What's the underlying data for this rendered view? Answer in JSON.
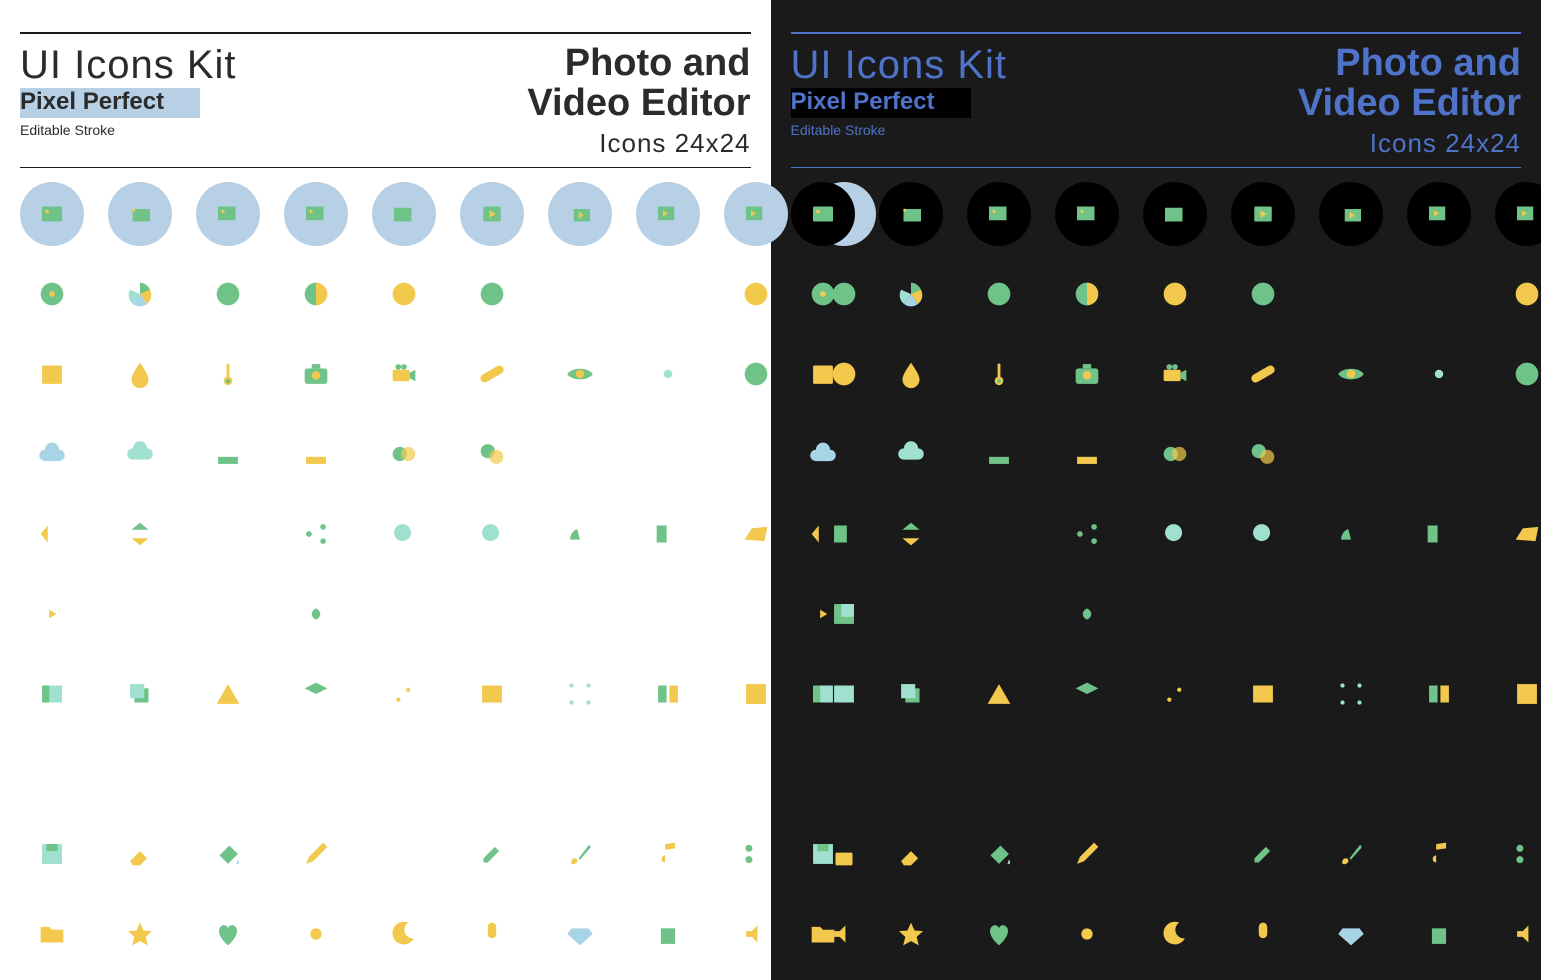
{
  "header": {
    "kit_title": "UI Icons Kit",
    "subtitle1": "Pixel Perfect",
    "subtitle2": "Editable Stroke",
    "right_line1": "Photo and",
    "right_line2": "Video Editor",
    "right_line3": "Icons 24x24"
  },
  "colors": {
    "light_bg": "#ffffff",
    "dark_bg": "#1a1a1a",
    "accent_light": "#b8d0e6",
    "accent_dark": "#4e73c8",
    "green": "#6fc388",
    "yellow": "#f2c94c",
    "blue": "#a8d5e6",
    "mint": "#9fe0d0"
  },
  "icons": [
    [
      {
        "n": "image",
        "c": true
      },
      {
        "n": "images",
        "c": true
      },
      {
        "n": "image-add",
        "c": true
      },
      {
        "n": "image-remove",
        "c": true
      },
      {
        "n": "image-sparkle",
        "c": true
      },
      {
        "n": "video",
        "c": true
      },
      {
        "n": "videos",
        "c": true
      },
      {
        "n": "video-add",
        "c": true
      },
      {
        "n": "video-remove",
        "c": true
      },
      {
        "n": "clapper",
        "c": true
      }
    ],
    [
      {
        "n": "record"
      },
      {
        "n": "color-wheel"
      },
      {
        "n": "aperture"
      },
      {
        "n": "contrast"
      },
      {
        "n": "time"
      },
      {
        "n": "clock"
      },
      {
        "n": "rotate-ccw"
      },
      {
        "n": "rotate-cw"
      },
      {
        "n": "help"
      },
      {
        "n": "info"
      }
    ],
    [
      {
        "n": "calendar"
      },
      {
        "n": "drop"
      },
      {
        "n": "thermometer"
      },
      {
        "n": "camera"
      },
      {
        "n": "camcorder"
      },
      {
        "n": "bandage"
      },
      {
        "n": "eye"
      },
      {
        "n": "gear"
      },
      {
        "n": "film-reel"
      },
      {
        "n": "smile"
      }
    ],
    [
      {
        "n": "cloud"
      },
      {
        "n": "cloud-up"
      },
      {
        "n": "download"
      },
      {
        "n": "upload"
      },
      {
        "n": "venn"
      },
      {
        "n": "overlap"
      },
      {
        "n": "sliders-v"
      },
      {
        "n": "sliders-h"
      },
      {
        "n": "more"
      },
      {
        "n": "menu"
      }
    ],
    [
      {
        "n": "flip-h"
      },
      {
        "n": "flip-v"
      },
      {
        "n": "audio-wave"
      },
      {
        "n": "share"
      },
      {
        "n": "zoom-in"
      },
      {
        "n": "zoom-out"
      },
      {
        "n": "speed"
      },
      {
        "n": "compare"
      },
      {
        "n": "perspective"
      },
      {
        "n": "select"
      }
    ],
    [
      {
        "n": "focus-play"
      },
      {
        "n": "focus-person"
      },
      {
        "n": "focus-face"
      },
      {
        "n": "focus-macro"
      },
      {
        "n": "external"
      },
      {
        "n": "expand"
      },
      {
        "n": "collapse"
      },
      {
        "n": "texture"
      },
      {
        "n": "crop"
      },
      {
        "n": "layer-top"
      }
    ],
    [
      {
        "n": "panel"
      },
      {
        "n": "layers"
      },
      {
        "n": "triangle"
      },
      {
        "n": "stack"
      },
      {
        "n": "curve"
      },
      {
        "n": "text-box"
      },
      {
        "n": "vector"
      },
      {
        "n": "columns"
      },
      {
        "n": "grid"
      },
      {
        "n": "film"
      }
    ],
    [
      {
        "n": "arrow-left"
      },
      {
        "n": "arrow-right"
      },
      {
        "n": "arrow-start"
      },
      {
        "n": "arrow-end"
      },
      {
        "n": "undo"
      },
      {
        "n": "redo"
      },
      {
        "n": "close"
      },
      {
        "n": "check"
      },
      {
        "n": "check-all"
      },
      {
        "n": "revert"
      }
    ],
    [
      {
        "n": "save"
      },
      {
        "n": "eraser"
      },
      {
        "n": "bucket"
      },
      {
        "n": "pencil"
      },
      {
        "n": "wand"
      },
      {
        "n": "dropper"
      },
      {
        "n": "brush"
      },
      {
        "n": "music"
      },
      {
        "n": "scissors"
      },
      {
        "n": "lock"
      }
    ],
    [
      {
        "n": "folder"
      },
      {
        "n": "star"
      },
      {
        "n": "heart"
      },
      {
        "n": "sun"
      },
      {
        "n": "moon"
      },
      {
        "n": "mic"
      },
      {
        "n": "diamond"
      },
      {
        "n": "trash"
      },
      {
        "n": "volume"
      },
      {
        "n": "mute"
      }
    ]
  ]
}
